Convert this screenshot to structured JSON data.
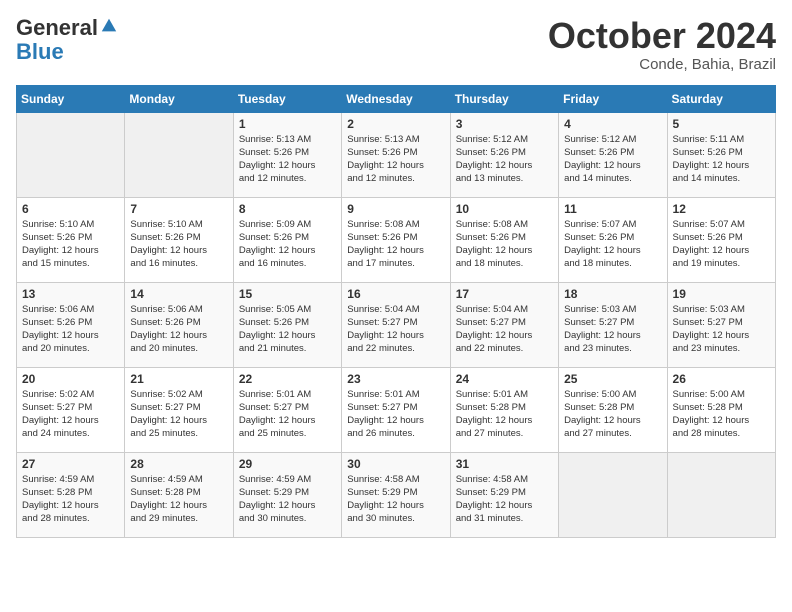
{
  "header": {
    "logo_general": "General",
    "logo_blue": "Blue",
    "month": "October 2024",
    "location": "Conde, Bahia, Brazil"
  },
  "days_of_week": [
    "Sunday",
    "Monday",
    "Tuesday",
    "Wednesday",
    "Thursday",
    "Friday",
    "Saturday"
  ],
  "weeks": [
    [
      {
        "day": "",
        "empty": true
      },
      {
        "day": "",
        "empty": true
      },
      {
        "day": "1",
        "sunrise": "5:13 AM",
        "sunset": "5:26 PM",
        "daylight": "12 hours and 12 minutes."
      },
      {
        "day": "2",
        "sunrise": "5:13 AM",
        "sunset": "5:26 PM",
        "daylight": "12 hours and 12 minutes."
      },
      {
        "day": "3",
        "sunrise": "5:12 AM",
        "sunset": "5:26 PM",
        "daylight": "12 hours and 13 minutes."
      },
      {
        "day": "4",
        "sunrise": "5:12 AM",
        "sunset": "5:26 PM",
        "daylight": "12 hours and 14 minutes."
      },
      {
        "day": "5",
        "sunrise": "5:11 AM",
        "sunset": "5:26 PM",
        "daylight": "12 hours and 14 minutes."
      }
    ],
    [
      {
        "day": "6",
        "sunrise": "5:10 AM",
        "sunset": "5:26 PM",
        "daylight": "12 hours and 15 minutes."
      },
      {
        "day": "7",
        "sunrise": "5:10 AM",
        "sunset": "5:26 PM",
        "daylight": "12 hours and 16 minutes."
      },
      {
        "day": "8",
        "sunrise": "5:09 AM",
        "sunset": "5:26 PM",
        "daylight": "12 hours and 16 minutes."
      },
      {
        "day": "9",
        "sunrise": "5:08 AM",
        "sunset": "5:26 PM",
        "daylight": "12 hours and 17 minutes."
      },
      {
        "day": "10",
        "sunrise": "5:08 AM",
        "sunset": "5:26 PM",
        "daylight": "12 hours and 18 minutes."
      },
      {
        "day": "11",
        "sunrise": "5:07 AM",
        "sunset": "5:26 PM",
        "daylight": "12 hours and 18 minutes."
      },
      {
        "day": "12",
        "sunrise": "5:07 AM",
        "sunset": "5:26 PM",
        "daylight": "12 hours and 19 minutes."
      }
    ],
    [
      {
        "day": "13",
        "sunrise": "5:06 AM",
        "sunset": "5:26 PM",
        "daylight": "12 hours and 20 minutes."
      },
      {
        "day": "14",
        "sunrise": "5:06 AM",
        "sunset": "5:26 PM",
        "daylight": "12 hours and 20 minutes."
      },
      {
        "day": "15",
        "sunrise": "5:05 AM",
        "sunset": "5:26 PM",
        "daylight": "12 hours and 21 minutes."
      },
      {
        "day": "16",
        "sunrise": "5:04 AM",
        "sunset": "5:27 PM",
        "daylight": "12 hours and 22 minutes."
      },
      {
        "day": "17",
        "sunrise": "5:04 AM",
        "sunset": "5:27 PM",
        "daylight": "12 hours and 22 minutes."
      },
      {
        "day": "18",
        "sunrise": "5:03 AM",
        "sunset": "5:27 PM",
        "daylight": "12 hours and 23 minutes."
      },
      {
        "day": "19",
        "sunrise": "5:03 AM",
        "sunset": "5:27 PM",
        "daylight": "12 hours and 23 minutes."
      }
    ],
    [
      {
        "day": "20",
        "sunrise": "5:02 AM",
        "sunset": "5:27 PM",
        "daylight": "12 hours and 24 minutes."
      },
      {
        "day": "21",
        "sunrise": "5:02 AM",
        "sunset": "5:27 PM",
        "daylight": "12 hours and 25 minutes."
      },
      {
        "day": "22",
        "sunrise": "5:01 AM",
        "sunset": "5:27 PM",
        "daylight": "12 hours and 25 minutes."
      },
      {
        "day": "23",
        "sunrise": "5:01 AM",
        "sunset": "5:27 PM",
        "daylight": "12 hours and 26 minutes."
      },
      {
        "day": "24",
        "sunrise": "5:01 AM",
        "sunset": "5:28 PM",
        "daylight": "12 hours and 27 minutes."
      },
      {
        "day": "25",
        "sunrise": "5:00 AM",
        "sunset": "5:28 PM",
        "daylight": "12 hours and 27 minutes."
      },
      {
        "day": "26",
        "sunrise": "5:00 AM",
        "sunset": "5:28 PM",
        "daylight": "12 hours and 28 minutes."
      }
    ],
    [
      {
        "day": "27",
        "sunrise": "4:59 AM",
        "sunset": "5:28 PM",
        "daylight": "12 hours and 28 minutes."
      },
      {
        "day": "28",
        "sunrise": "4:59 AM",
        "sunset": "5:28 PM",
        "daylight": "12 hours and 29 minutes."
      },
      {
        "day": "29",
        "sunrise": "4:59 AM",
        "sunset": "5:29 PM",
        "daylight": "12 hours and 30 minutes."
      },
      {
        "day": "30",
        "sunrise": "4:58 AM",
        "sunset": "5:29 PM",
        "daylight": "12 hours and 30 minutes."
      },
      {
        "day": "31",
        "sunrise": "4:58 AM",
        "sunset": "5:29 PM",
        "daylight": "12 hours and 31 minutes."
      },
      {
        "day": "",
        "empty": true
      },
      {
        "day": "",
        "empty": true
      }
    ]
  ],
  "labels": {
    "sunrise_prefix": "Sunrise: ",
    "sunset_prefix": "Sunset: ",
    "daylight_prefix": "Daylight: "
  }
}
